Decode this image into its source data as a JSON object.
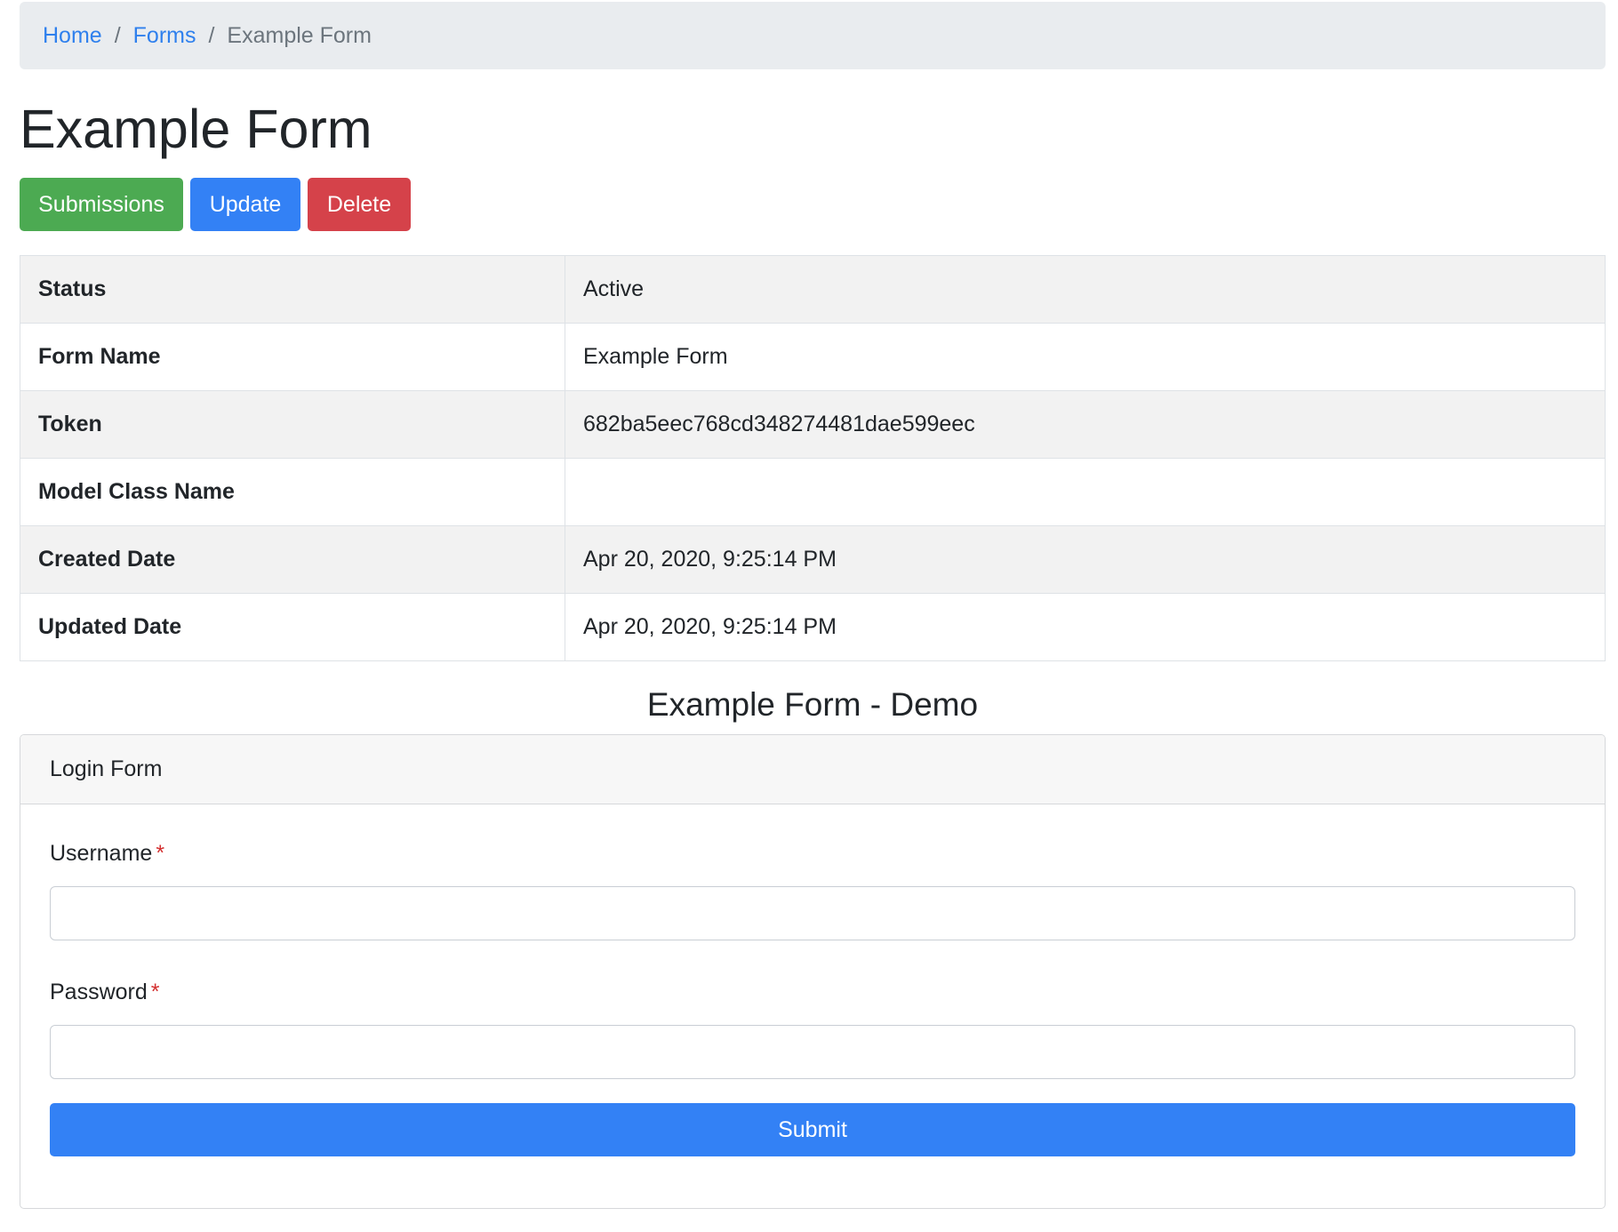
{
  "breadcrumb": {
    "items": [
      {
        "label": "Home"
      },
      {
        "label": "Forms"
      }
    ],
    "current": "Example Form",
    "separator": "/"
  },
  "page_title": "Example Form",
  "actions": {
    "submissions_label": "Submissions",
    "update_label": "Update",
    "delete_label": "Delete"
  },
  "details": [
    {
      "key": "Status",
      "value": "Active"
    },
    {
      "key": "Form Name",
      "value": "Example Form"
    },
    {
      "key": "Token",
      "value": "682ba5eec768cd348274481dae599eec"
    },
    {
      "key": "Model Class Name",
      "value": ""
    },
    {
      "key": "Created Date",
      "value": "Apr 20, 2020, 9:25:14 PM"
    },
    {
      "key": "Updated Date",
      "value": "Apr 20, 2020, 9:25:14 PM"
    }
  ],
  "demo": {
    "title": "Example Form - Demo",
    "card_title": "Login Form",
    "fields": [
      {
        "label": "Username",
        "required_mark": "*",
        "value": ""
      },
      {
        "label": "Password",
        "required_mark": "*",
        "value": ""
      }
    ],
    "submit_label": "Submit"
  },
  "colors": {
    "link": "#2f80ed",
    "success": "#4caa52",
    "primary": "#3381f5",
    "danger": "#d5424a",
    "required": "#d32f2f"
  }
}
